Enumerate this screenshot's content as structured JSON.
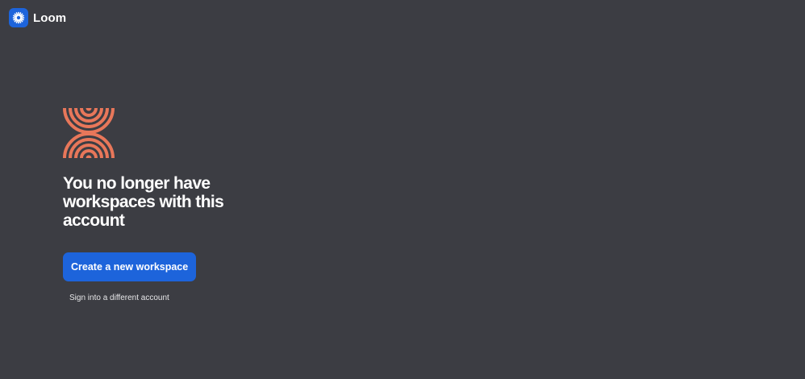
{
  "header": {
    "brand_name": "Loom",
    "logo_icon": "loom-starburst-icon"
  },
  "main": {
    "illustration": "concentric-arches-illustration",
    "headline": "You no longer have workspaces with this account",
    "create_button_label": "Create a new workspace",
    "sign_in_link_label": "Sign into a different account"
  },
  "colors": {
    "background": "#3c3d43",
    "brand_blue": "#1d64db",
    "illustration_orange": "#e8775a"
  }
}
